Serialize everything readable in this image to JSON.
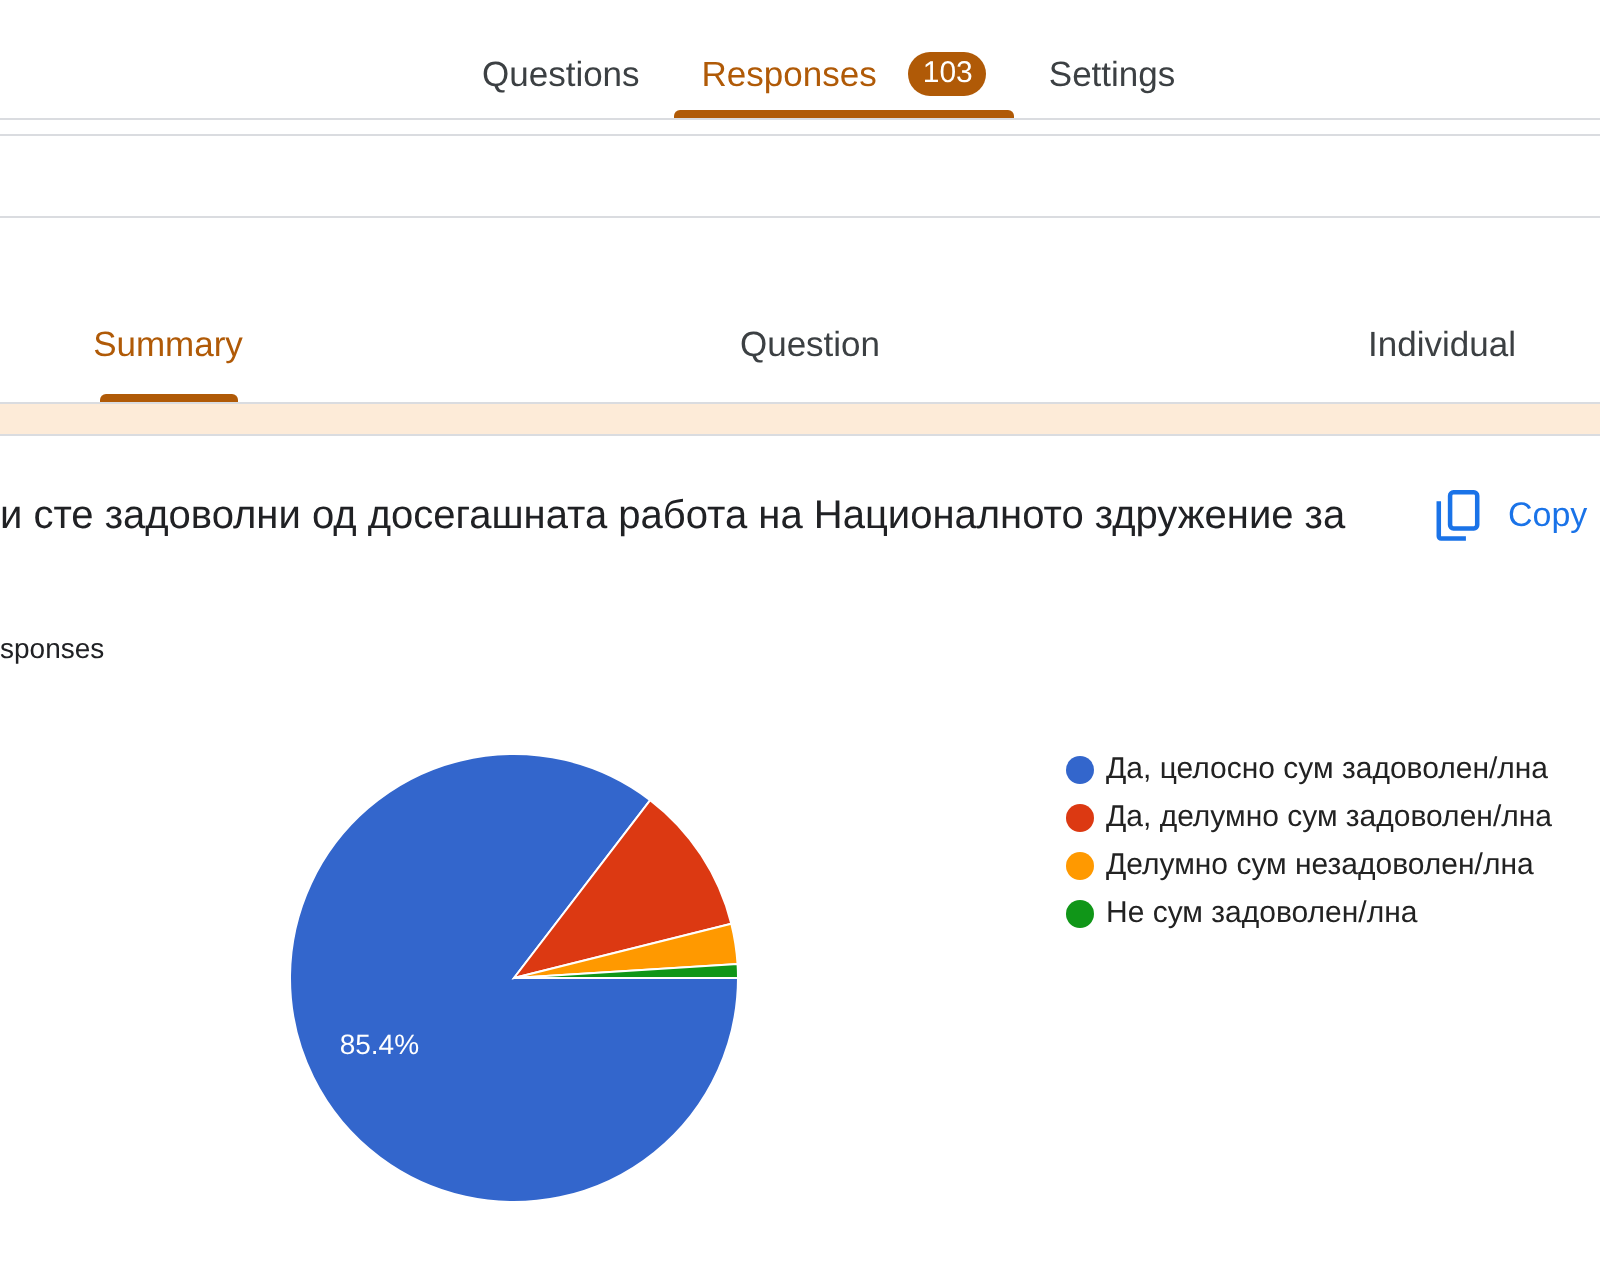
{
  "top_tabs": [
    {
      "label": "Questions",
      "selected": false
    },
    {
      "label": "Responses",
      "selected": true,
      "badge": "103"
    },
    {
      "label": "Settings",
      "selected": false
    }
  ],
  "response_tabs": [
    {
      "label": "Summary",
      "selected": true
    },
    {
      "label": "Question",
      "selected": false
    },
    {
      "label": "Individual",
      "selected": false
    }
  ],
  "question": {
    "title": "и сте задоволни од досегашната работа на Националното здружение за",
    "copy_button": "Copy",
    "response_count_label": "sponses",
    "chart_data": {
      "type": "pie",
      "categories": [
        "Да, целосно сум задоволен/лна",
        "Да, делумно сум задоволен/лна",
        "Делумно сум незадоволен/лна",
        "Не сум задоволен/лна"
      ],
      "values": [
        85.4,
        10.7,
        2.9,
        1.0
      ],
      "colors": [
        "#3366cc",
        "#dc3912",
        "#ff9900",
        "#109618"
      ],
      "value_labels": [
        "85.4%",
        null,
        null,
        null
      ],
      "legend": "right"
    }
  }
}
